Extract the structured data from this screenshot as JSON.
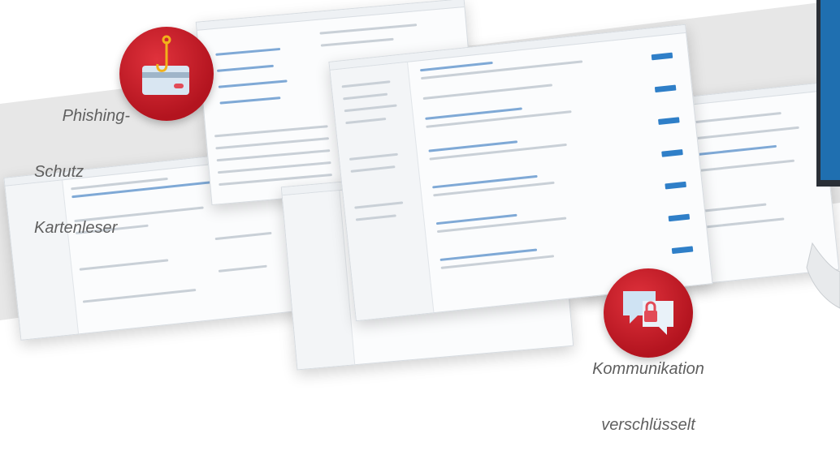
{
  "callouts": {
    "phishing": {
      "lines": [
        "Phishing-",
        "Schutz",
        "Kartenleser"
      ],
      "icon": "hooked-credit-card-icon"
    },
    "communication": {
      "lines": [
        "Kommunikation",
        "verschlüsselt"
      ],
      "icon": "encrypted-chat-icon"
    }
  },
  "colors": {
    "badge_red": "#c8202b",
    "band_gray": "#e6e6e6",
    "text_gray": "#5f5f5f",
    "accent_blue": "#2f7fc8"
  }
}
